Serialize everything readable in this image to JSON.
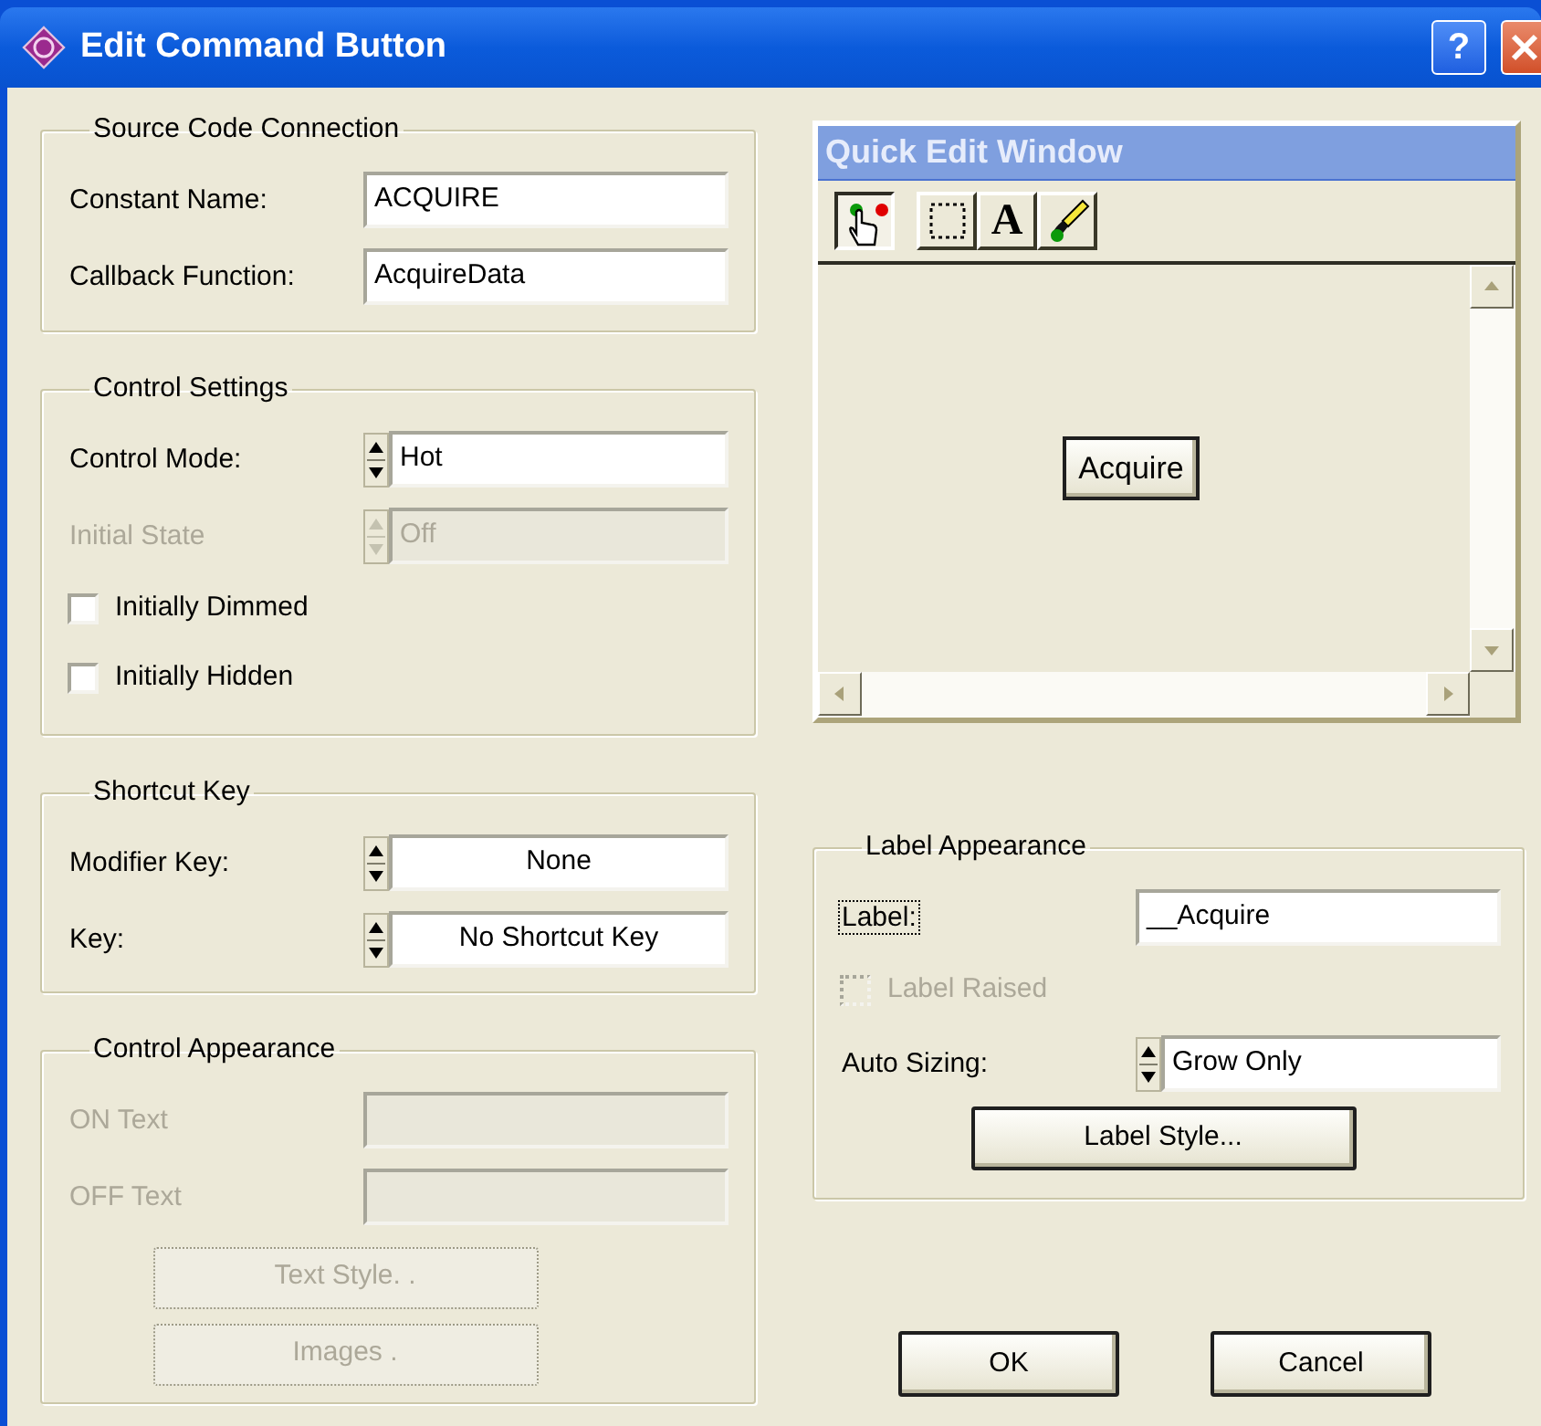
{
  "window": {
    "title": "Edit Command Button",
    "help_label": "?"
  },
  "source_code_connection": {
    "title": "Source Code Connection",
    "rows": [
      {
        "kind": "text",
        "label": "Constant Name:",
        "value": "ACQUIRE",
        "disabled": false
      },
      {
        "kind": "text",
        "label": "Callback Function:",
        "value": "AcquireData",
        "disabled": false
      }
    ]
  },
  "control_settings": {
    "title": "Control Settings",
    "rows": [
      {
        "kind": "spinner",
        "label": "Control Mode:",
        "value": "Hot",
        "disabled": false
      },
      {
        "kind": "spinner",
        "label": "Initial State",
        "value": "Off",
        "disabled": true
      },
      {
        "kind": "checkbox",
        "label": "Initially Dimmed",
        "checked": false,
        "disabled": false
      },
      {
        "kind": "checkbox",
        "label": "Initially Hidden",
        "checked": false,
        "disabled": false
      }
    ]
  },
  "shortcut_key": {
    "title": "Shortcut Key",
    "rows": [
      {
        "kind": "spinner",
        "label": "Modifier Key:",
        "value": "None",
        "disabled": false
      },
      {
        "kind": "spinner",
        "label": "Key:",
        "value": "No Shortcut Key",
        "disabled": false
      }
    ]
  },
  "control_appearance": {
    "title": "Control Appearance",
    "rows": [
      {
        "kind": "text",
        "label": "ON Text",
        "disabled": true
      },
      {
        "kind": "text",
        "label": "OFF Text",
        "disabled": true
      }
    ],
    "buttons": [
      {
        "label": "Text Style. .",
        "disabled": true
      },
      {
        "label": "Images .",
        "disabled": true
      }
    ]
  },
  "quick_edit": {
    "title": "Quick Edit Window",
    "tools": [
      {
        "kind": "operate",
        "selected": true
      },
      {
        "kind": "select",
        "selected": false
      },
      {
        "kind": "text",
        "label": "A",
        "selected": false
      },
      {
        "kind": "color",
        "selected": false
      }
    ],
    "preview_button": {
      "label": "Acquire"
    }
  },
  "label_appearance": {
    "title": "Label Appearance",
    "rows": [
      {
        "kind": "text",
        "label": "Label:",
        "value": "__Acquire",
        "disabled": false,
        "focused": true
      },
      {
        "kind": "checkbox",
        "label": "Label Raised",
        "checked": false,
        "disabled": true
      },
      {
        "kind": "spinner",
        "label": "Auto Sizing:",
        "value": "Grow Only",
        "disabled": false
      }
    ],
    "buttons": [
      {
        "label": "Label Style...",
        "disabled": false
      }
    ]
  },
  "buttons": [
    {
      "label": "OK"
    },
    {
      "label": "Cancel"
    }
  ]
}
